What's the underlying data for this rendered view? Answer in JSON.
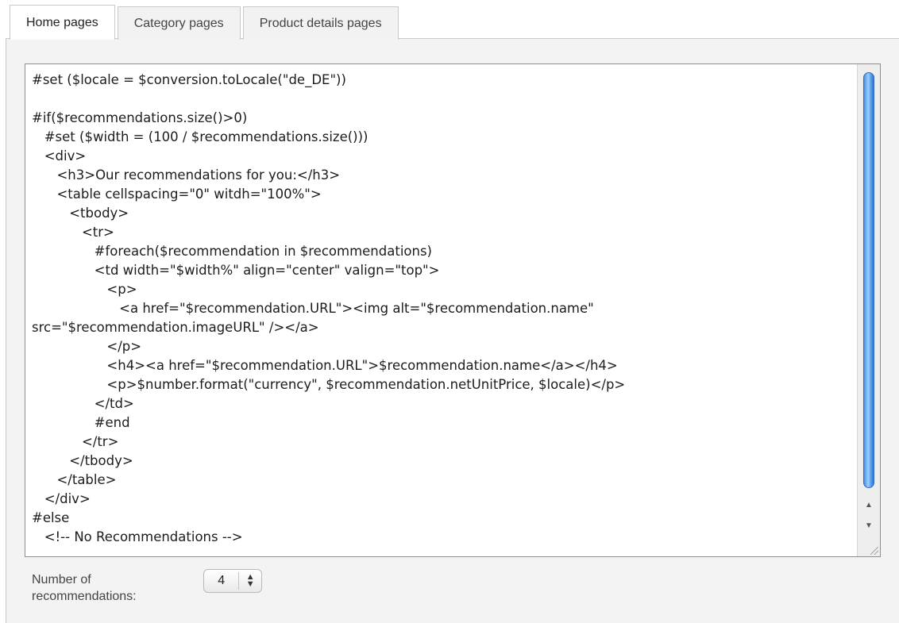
{
  "tabs": [
    {
      "label": "Home pages",
      "active": true
    },
    {
      "label": "Category pages",
      "active": false
    },
    {
      "label": "Product details pages",
      "active": false
    }
  ],
  "editor": {
    "lines": [
      "#set ($locale = $conversion.toLocale(\"de_DE\"))",
      "",
      "#if($recommendations.size()>0)",
      "   #set ($width = (100 / $recommendations.size()))",
      "   <div>",
      "      <h3>Our recommendations for you:</h3>",
      "      <table cellspacing=\"0\" witdh=\"100%\">",
      "         <tbody>",
      "            <tr>",
      "               #foreach($recommendation in $recommendations)",
      "               <td width=\"$width%\" align=\"center\" valign=\"top\">",
      "                  <p>",
      "                     <a href=\"$recommendation.URL\"><img alt=\"$recommendation.name\"",
      "src=\"$recommendation.imageURL\" /></a>",
      "                  </p>",
      "                  <h4><a href=\"$recommendation.URL\">$recommendation.name</a></h4>",
      "                  <p>$number.format(\"currency\", $recommendation.netUnitPrice, $locale)</p>",
      "               </td>",
      "               #end",
      "            </tr>",
      "         </tbody>",
      "      </table>",
      "   </div>",
      "#else",
      "   <!-- No Recommendations -->"
    ],
    "scroll_position": 0.0
  },
  "number_of_recommendations": {
    "label": "Number of recommendations:",
    "value": "4"
  },
  "colors": {
    "scroll_thumb": "#4a8fe0",
    "panel_background": "#f3f3f3",
    "border": "#c9c9c9"
  },
  "icons": {
    "scroll_up": "up-arrow-icon",
    "scroll_down": "down-arrow-icon",
    "stepper": "up-down-arrows-icon",
    "resize": "resize-grip-icon"
  }
}
